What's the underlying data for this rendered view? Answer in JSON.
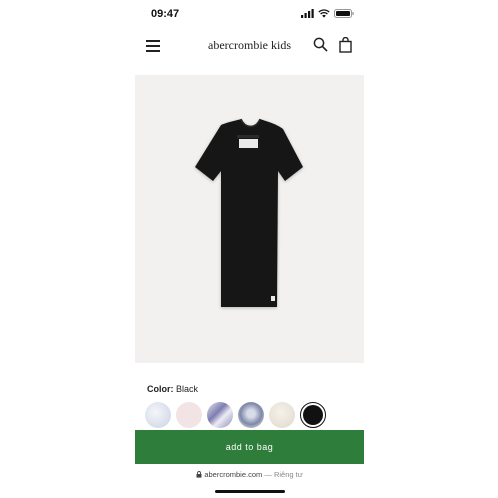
{
  "status_bar": {
    "time": "09:47"
  },
  "header": {
    "brand": "abercrombie kids"
  },
  "icons": {
    "menu": "hamburger-menu-icon",
    "search": "search-icon",
    "bag": "shopping-bag-icon",
    "signal": "cellular-signal-icon",
    "wifi": "wifi-icon",
    "battery": "battery-icon",
    "lock": "lock-icon"
  },
  "product": {
    "color_label": "Color:",
    "color_value": "Black",
    "swatches": [
      {
        "name": "light-blue",
        "color": "#dfe5ee"
      },
      {
        "name": "light-pink",
        "color": "#f2e4e4"
      },
      {
        "name": "tie-dye",
        "color": "#a8a8c8"
      },
      {
        "name": "blue-print",
        "color": "#b8bed0"
      },
      {
        "name": "cream",
        "color": "#ece6dc"
      },
      {
        "name": "black",
        "color": "#111111",
        "selected": true
      }
    ],
    "image": {
      "shirt_color": "#151515",
      "bg": "#f2f1ef"
    }
  },
  "cta": {
    "label": "add to bag",
    "color": "#2e7d3a"
  },
  "browser": {
    "domain": "abercrombie.com",
    "separator": "—",
    "private_label": "Riêng tư"
  }
}
